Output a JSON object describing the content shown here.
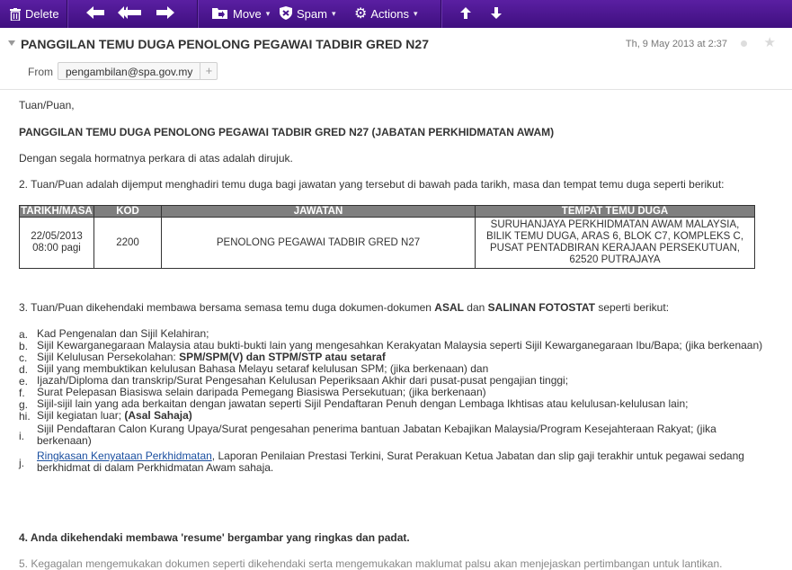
{
  "toolbar": {
    "delete": "Delete",
    "move": "Move",
    "spam": "Spam",
    "actions": "Actions"
  },
  "email": {
    "subject": "PANGGILAN TEMU DUGA PENOLONG PEGAWAI TADBIR GRED N27",
    "date": "Th, 9 May 2013 at 2:37",
    "from_label": "From",
    "from_email": "pengambilan@spa.gov.my",
    "from_plus": "+"
  },
  "body": {
    "greeting": "Tuan/Puan,",
    "heading": "PANGGILAN TEMU DUGA PENOLONG PEGAWAI TADBIR GRED N27 (JABATAN PERKHIDMATAN AWAM)",
    "p_ref": "Dengan segala hormatnya perkara di atas adalah dirujuk.",
    "p2": "2.  Tuan/Puan adalah dijemput menghadiri temu duga bagi jawatan yang tersebut di bawah pada tarikh, masa dan tempat temu duga seperti berikut:",
    "table": {
      "headers": [
        "TARIKH/MASA",
        "KOD",
        "JAWATAN",
        "TEMPAT TEMU DUGA"
      ],
      "row": {
        "date": "22/05/2013",
        "time": "08:00 pagi",
        "kod": "2200",
        "jawatan": "PENOLONG PEGAWAI TADBIR GRED N27",
        "tempat_1": "SURUHANJAYA PERKHIDMATAN AWAM MALAYSIA,",
        "tempat_2": "BILIK TEMU DUGA, ARAS 6, BLOK C7, KOMPLEKS C,",
        "tempat_3": "PUSAT PENTADBIRAN KERAJAAN PERSEKUTUAN,",
        "tempat_4": "62520 PUTRAJAYA"
      }
    },
    "p3_a": "3.  Tuan/Puan dikehendaki membawa bersama semasa temu duga dokumen-dokumen ",
    "p3_b": "ASAL",
    "p3_c": " dan ",
    "p3_d": "SALINAN FOTOSTAT",
    "p3_e": " seperti berikut:",
    "items": {
      "a_l": "a.",
      "a": "Kad Pengenalan dan Sijil Kelahiran;",
      "b_l": "b.",
      "b": "Sijil Kewarganegaraan Malaysia atau bukti-bukti lain yang mengesahkan Kerakyatan Malaysia seperti Sijil Kewarganegaraan Ibu/Bapa; (jika berkenaan)",
      "c_l": "c.",
      "c1": "Sijil Kelulusan Persekolahan: ",
      "c2": "SPM/SPM(V) dan STPM/STP atau setaraf",
      "d_l": "d.",
      "d": "Sijil yang membuktikan kelulusan Bahasa Melayu setaraf kelulusan SPM; (jika berkenaan) dan",
      "e_l": "e.",
      "e": "Ijazah/Diploma dan transkrip/Surat Pengesahan Kelulusan Peperiksaan Akhir dari pusat-pusat pengajian tinggi;",
      "f_l": "f.",
      "f": "Surat Pelepasan Biasiswa selain daripada Pemegang Biasiswa Persekutuan; (jika berkenaan)",
      "g_l": "g.",
      "g": "Sijil-sijil lain yang ada berkaitan dengan jawatan seperti Sijil Pendaftaran Penuh dengan Lembaga Ikhtisas atau kelulusan-kelulusan lain;",
      "hi_l": "hi.",
      "hi1": "Sijil kegiatan luar; ",
      "hi2": "(Asal Sahaja)",
      "i_l": "i.",
      "i1": "Sijil Pendaftaran Calon Kurang Upaya/Surat pengesahan penerima bantuan Jabatan Kebajikan Malaysia/Program Kesejahteraan Rakyat; (jika",
      "i2": "berkenaan)",
      "j_l": "j.",
      "j_link": "Ringkasan Kenyataan Perkhidmatan",
      "j1": ", Laporan Penilaian Prestasi Terkini, Surat Perakuan Ketua Jabatan dan slip gaji terakhir untuk pegawai sedang",
      "j2": "berkhidmat di dalam Perkhidmatan Awam sahaja."
    },
    "p4": "4.  Anda dikehendaki membawa 'resume' bergambar yang ringkas dan padat.",
    "p5": "5.  Kegagalan mengemukakan dokumen seperti dikehendaki serta mengemukakan maklumat palsu akan menjejaskan pertimbangan untuk lantikan."
  }
}
